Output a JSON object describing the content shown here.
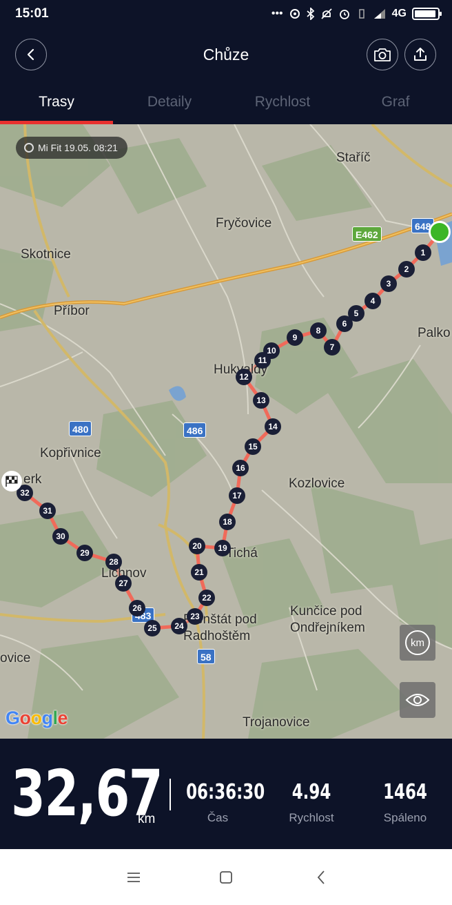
{
  "status_bar": {
    "time": "15:01",
    "network": "4G",
    "icons": [
      "more-icon",
      "hotspot-icon",
      "bluetooth-icon",
      "mute-icon",
      "alarm-icon",
      "vibrate-icon",
      "signal-icon",
      "battery-icon"
    ]
  },
  "header": {
    "title": "Chůze",
    "back_icon": "chevron-left-icon",
    "camera_icon": "camera-icon",
    "share_icon": "upload-icon"
  },
  "tabs": [
    {
      "label": "Trasy",
      "active": true
    },
    {
      "label": "Detaily",
      "active": false
    },
    {
      "label": "Rychlost",
      "active": false
    },
    {
      "label": "Graf",
      "active": false
    }
  ],
  "map": {
    "source": "Mi Fit 19.05. 08:21",
    "labels": {
      "staric": "Staříč",
      "frycovice": "Fryčovice",
      "skotnice": "Skotnice",
      "pribor": "Příbor",
      "palkovice": "Palko",
      "hukvaldy": "Hukvaldy",
      "koprivnice": "Kopřivnice",
      "kozlovice": "Kozlovice",
      "sterk": "erk",
      "ticha": "Tichá",
      "lichnov": "Lichnov",
      "frenstat": "Frenštát pod\nRadhoštěm",
      "kuncice": "Kunčice pod\nOndřejníkem",
      "ovice": "ovice",
      "trojanovice": "Trojanovice"
    },
    "road_shields": {
      "r648": "648",
      "e462": "E462",
      "r480": "480",
      "r486": "486",
      "r483": "483",
      "r58": "58"
    },
    "km_button_label": "km",
    "google_logo": "Google",
    "colors": {
      "route": "#f06a5a",
      "marker": "#1a1f36",
      "start": "#3cb626"
    },
    "route_markers": [
      "1",
      "2",
      "3",
      "4",
      "5",
      "6",
      "7",
      "8",
      "9",
      "10",
      "11",
      "12",
      "13",
      "14",
      "15",
      "16",
      "17",
      "18",
      "19",
      "20",
      "21",
      "22",
      "23",
      "24",
      "25",
      "26",
      "27",
      "28",
      "29",
      "30",
      "31",
      "32"
    ]
  },
  "stats": {
    "distance": "32,67",
    "distance_unit": "km",
    "items": [
      {
        "value": "06:36:30",
        "label": "Čas"
      },
      {
        "value": "4.94",
        "label": "Rychlost"
      },
      {
        "value": "1464",
        "label": "Spáleno"
      }
    ]
  },
  "navbar": {
    "icons": [
      "menu-icon",
      "home-square-icon",
      "back-triangle-icon"
    ]
  }
}
